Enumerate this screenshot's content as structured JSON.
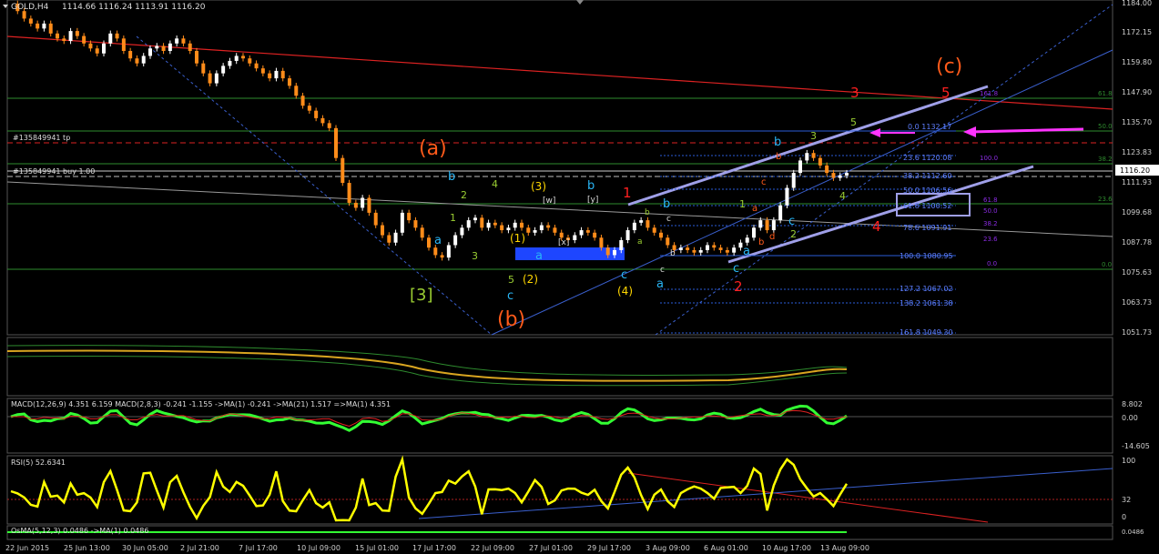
{
  "header": {
    "symbol": "GOLD,H4",
    "ohlc": "1114.66 1116.24 1113.91 1116.20"
  },
  "colors": {
    "background": "#000000",
    "bull_candle": "#ffffff",
    "bear_candle": "#ff8c1a",
    "grid": "#1a1a1a",
    "axis_text": "#cfcfcf",
    "current_price_box": "#ffffff"
  },
  "price_axis": {
    "ticks": [
      "1184.00",
      "1172.15",
      "1159.80",
      "1147.90",
      "1135.70",
      "1123.83",
      "1111.93",
      "1099.68",
      "1087.78",
      "1075.63",
      "1063.73",
      "1051.73"
    ],
    "current": "1116.20"
  },
  "macd_axis": {
    "ticks": [
      "8.802",
      "0.00",
      "-14.605"
    ],
    "current": "4.351"
  },
  "rsi_axis": {
    "ticks": [
      "100",
      "32",
      "0"
    ]
  },
  "osma_axis": {
    "ticks": [
      "0.0486"
    ]
  },
  "time_axis": {
    "ticks": [
      "22 Jun 2015",
      "25 Jun 13:00",
      "30 Jun 05:00",
      "2 Jul 21:00",
      "7 Jul 17:00",
      "10 Jul 09:00",
      "15 Jul 01:00",
      "17 Jul 17:00",
      "22 Jul 09:00",
      "27 Jul 01:00",
      "29 Jul 17:00",
      "3 Aug 09:00",
      "6 Aug 01:00",
      "10 Aug 17:00",
      "13 Aug 09:00"
    ]
  },
  "orders": {
    "tp": "#135849941 tp",
    "buy": "#135849941 buy 1.00"
  },
  "indicators": {
    "macd": "MACD(12,26,9) 4.351 6.159  MACD(2,8,3) -0.241 -1.155  ->MA(1) -0.241  ->MA(21) 1.517  =>MA(1) 4.351",
    "rsi": "RSI(5) 52.6341",
    "osma": "OsMA(5,12,3) 0.0486  ->MA(1) 0.0486"
  },
  "fib_retracement": [
    {
      "label": "0.0 1132.17"
    },
    {
      "label": "23.6 1120.08"
    },
    {
      "label": "38.2 1112.60"
    },
    {
      "label": "50.0 1106.56"
    },
    {
      "label": "61.8 1100.52"
    },
    {
      "label": "78.6 1091.91"
    },
    {
      "label": "100.0 1080.95"
    },
    {
      "label": "127.2 1067.02"
    },
    {
      "label": "138.2 1061.38"
    },
    {
      "label": "161.8 1049.30"
    }
  ],
  "fib_secondary": [
    "161.8",
    "100.0",
    "61.8",
    "50.0",
    "38.2",
    "23.6",
    "0.0"
  ],
  "fib_right_edge": [
    "61.8",
    "50.0",
    "38.2",
    "23.6",
    "0.0"
  ],
  "wave_labels": {
    "big_c": "(c)",
    "big_a": "(a)",
    "big_b": "(b)",
    "bracket3": "[3]",
    "w": "[w]",
    "x": "[x]",
    "y": "[y]",
    "red1": "1",
    "red2": "2",
    "red3": "3",
    "red4": "4",
    "red5": "5",
    "yel_1": "(1)",
    "yel_2": "(2)",
    "yel_3": "(3)",
    "yel_4": "(4)",
    "grn_1": "1",
    "grn_2": "2",
    "grn_3": "3",
    "grn_4": "4",
    "grn_5": "5",
    "blue_a": "a",
    "blue_b": "b",
    "blue_c": "c",
    "small_a": "a",
    "small_b": "b",
    "small_c": "c",
    "small_d": "d"
  },
  "chart_data": {
    "type": "line",
    "title": "GOLD,H4",
    "ylim": [
      1051.73,
      1184.0
    ],
    "series": [
      {
        "name": "",
        "values": [
          1184,
          1181,
          1178,
          1176,
          1174,
          1176,
          1172,
          1170,
          1169,
          1173,
          1171,
          1168,
          1166,
          1164,
          1168,
          1172,
          1170,
          1165,
          1162,
          1160,
          1163,
          1166,
          1167,
          1165,
          1168,
          1170,
          1168,
          1165,
          1160,
          1156,
          1152,
          1156,
          1159,
          1161,
          1163,
          1162,
          1160,
          1158,
          1156,
          1154,
          1157,
          1154,
          1151,
          1147,
          1143,
          1141,
          1138,
          1136,
          1134,
          1122,
          1112,
          1104,
          1102,
          1106,
          1100,
          1095,
          1091,
          1088,
          1092,
          1100,
          1097,
          1094,
          1090,
          1086,
          1083,
          1082,
          1087,
          1091,
          1094,
          1097,
          1098,
          1094,
          1096,
          1095,
          1093,
          1094,
          1096,
          1094,
          1092,
          1093,
          1095,
          1094,
          1092,
          1090,
          1089,
          1091,
          1093,
          1092,
          1090,
          1086,
          1083,
          1085,
          1089,
          1093,
          1096,
          1097,
          1094,
          1092,
          1090,
          1087,
          1085,
          1086,
          1085,
          1084,
          1085,
          1087,
          1086,
          1085,
          1084,
          1086,
          1088,
          1090,
          1094,
          1097,
          1093,
          1097,
          1103,
          1110,
          1116,
          1121,
          1124,
          1122,
          1119,
          1116,
          1114,
          1115,
          1116
        ]
      }
    ]
  }
}
